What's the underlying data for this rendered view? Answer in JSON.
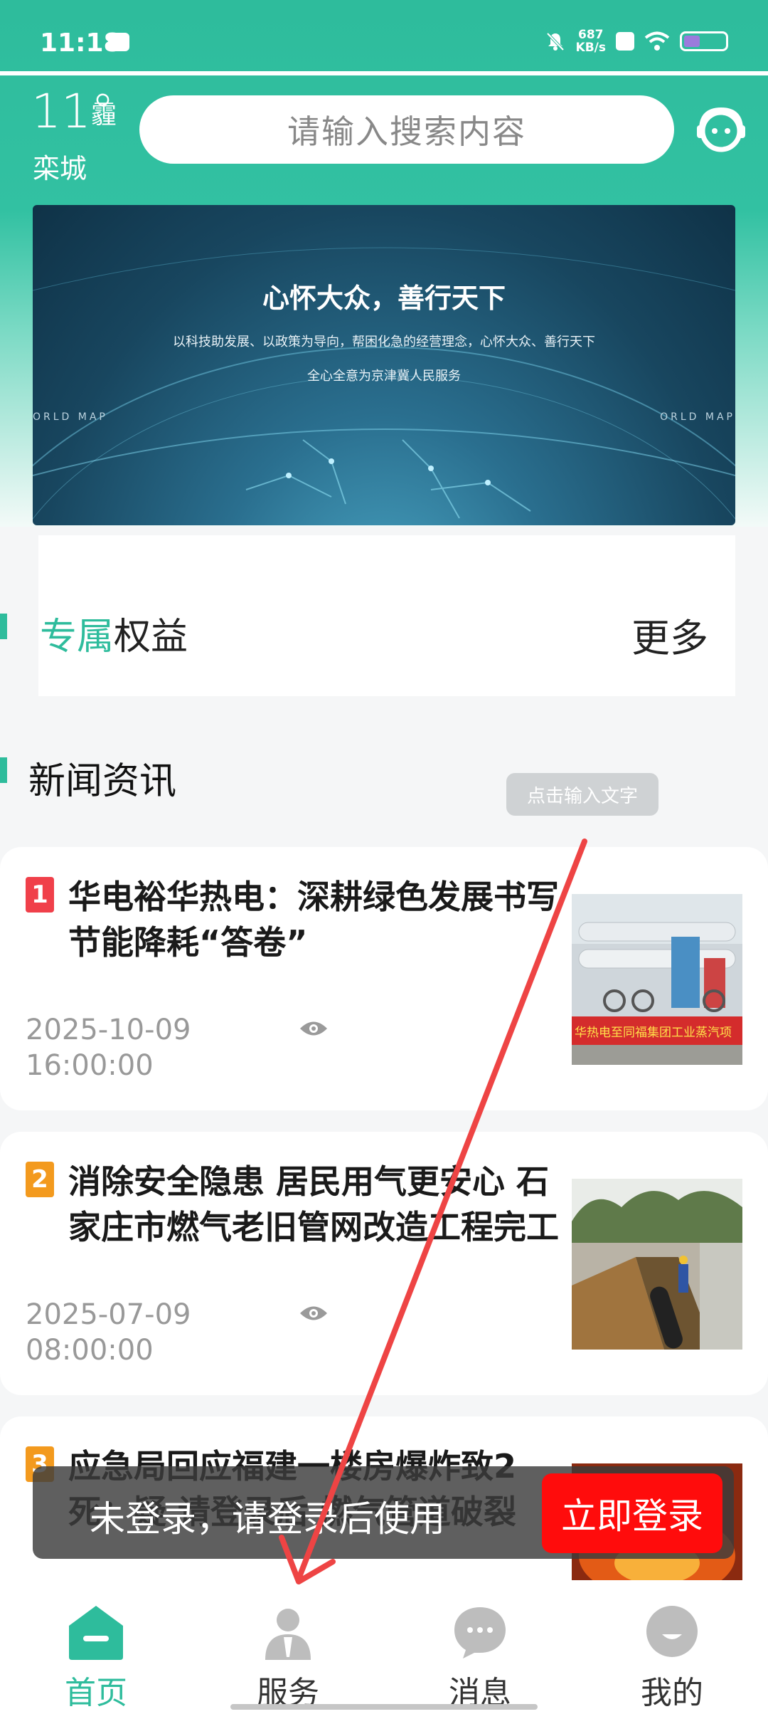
{
  "status_bar": {
    "time": "11:18",
    "speed_value": "687",
    "speed_unit": "KB/s"
  },
  "weather": {
    "temperature": "11°",
    "condition": "霾",
    "city": "栾城"
  },
  "search": {
    "placeholder": "请输入搜索内容"
  },
  "banner": {
    "title": "心怀大众，善行天下",
    "subtitle": "以科技助发展、以政策为导向，帮困化急的经营理念，心怀大众、善行天下",
    "subtitle2": "全心全意为京津冀人民服务",
    "map_left": "ORLD MAP",
    "map_right": "ORLD MAP"
  },
  "benefits": {
    "title_accent": "专属",
    "title_rest": "权益",
    "more": "更多"
  },
  "news": {
    "section_title": "新闻资讯",
    "tip_bubble": "点击输入文字",
    "items": [
      {
        "rank": "1",
        "headline": "华电裕华热电：深耕绿色发展书写节能降耗“答卷”",
        "date": "2025-10-09",
        "time": "16:00:00",
        "thumb_caption": "华热电至同福集团工业蒸汽项"
      },
      {
        "rank": "2",
        "headline": "消除安全隐患 居民用气更安心 石家庄市燃气老旧管网改造工程完工",
        "date": "2025-07-09",
        "time": "08:00:00"
      },
      {
        "rank": "3",
        "headline": "应急局回应福建一楼房爆炸致2死：疑 请登录后 燃气管道破裂"
      }
    ]
  },
  "toast": {
    "message": "未登录，请登录后使用",
    "login_button": "立即登录"
  },
  "tabbar": {
    "items": [
      {
        "label": "首页",
        "active": true
      },
      {
        "label": "服务",
        "active": false
      },
      {
        "label": "消息",
        "active": false
      },
      {
        "label": "我的",
        "active": false
      }
    ]
  },
  "colors": {
    "primary": "#2ebc9c",
    "login_red": "#ff0c0c",
    "rank1": "#f0404a",
    "rank2": "#f39a1e",
    "rank3": "#f39a1e",
    "arrow": "#ee4444"
  }
}
